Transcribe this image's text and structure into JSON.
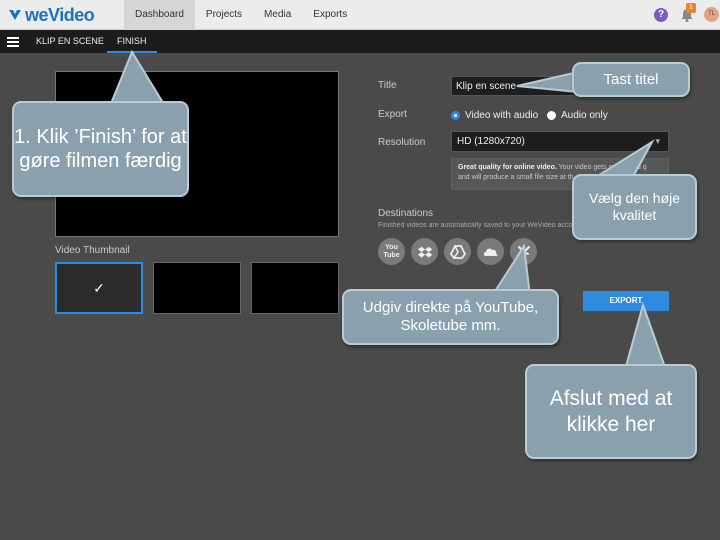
{
  "app": {
    "logo": "weVideo"
  },
  "nav": {
    "items": [
      "Dashboard",
      "Projects",
      "Media",
      "Exports"
    ],
    "active": 0
  },
  "header": {
    "help": "?",
    "notifications_count": "1",
    "avatar_initials": "TL"
  },
  "subnav": {
    "tabs": [
      "KLIP EN SCENE",
      "FINISH"
    ],
    "active": 1
  },
  "thumbnails": {
    "label": "Video Thumbnail",
    "check": "✓"
  },
  "form": {
    "title_label": "Title",
    "title_value": "Klip en scene",
    "export_label": "Export",
    "export_options": [
      "Video with audio",
      "Audio only"
    ],
    "export_selected": 0,
    "resolution_label": "Resolution",
    "resolution_value": "HD (1280x720)",
    "resolution_desc_bold": "Great quality for online video.",
    "resolution_desc_rest": "Your video gets processed q",
    "resolution_desc_line2": "and will produce a small file size at th",
    "destinations_label": "Destinations",
    "destinations_desc": "Finished videos are automatically saved to your WeVideo acco",
    "destinations": [
      "youtube-icon",
      "dropbox-icon",
      "drive-icon",
      "cloud-icon",
      "skoletube-icon"
    ],
    "youtube_text": "You Tube",
    "export_button": "EXPORT"
  },
  "callouts": {
    "finish": "1. Klik ’Finish’ for at gøre filmen færdig",
    "title": "Tast titel",
    "quality": "Vælg den høje kvalitet",
    "publish": "Udgiv direkte på YouTube, Skoletube mm.",
    "export": "Afslut med at klikke her"
  },
  "colors": {
    "accent": "#2f8be0",
    "callout": "#8aa0ad",
    "background": "#4a4a4a"
  }
}
